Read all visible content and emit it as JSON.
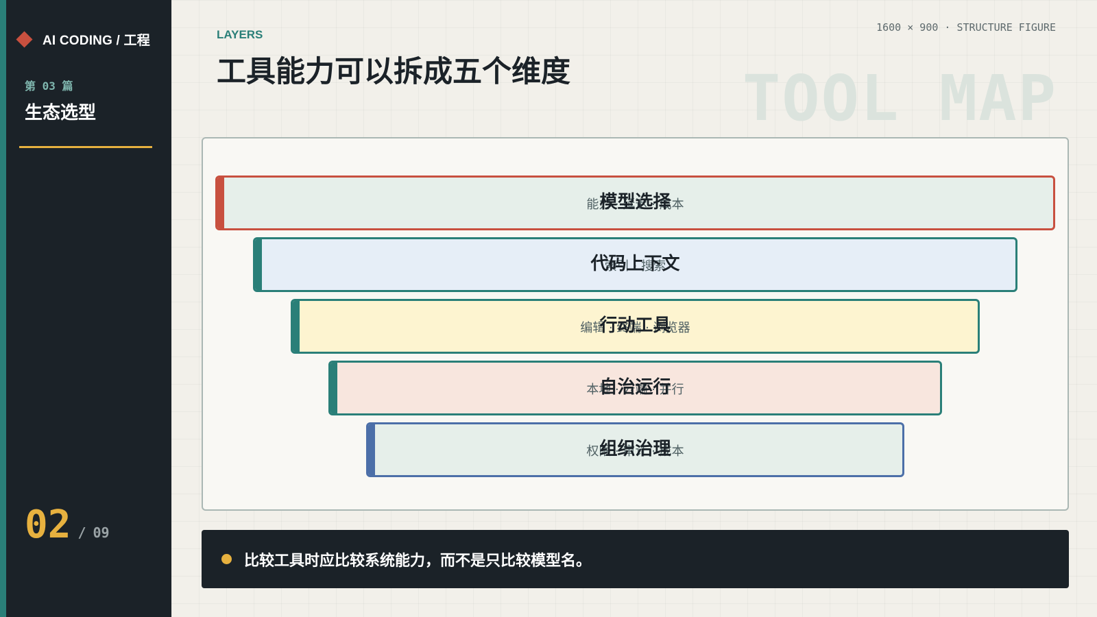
{
  "sidebar": {
    "brand": "AI CODING / 工程",
    "brand_icon": "diamond-icon",
    "chapter": "第 03 篇",
    "section": "生态选型",
    "page_current": "02",
    "page_separator": "/",
    "page_total": "09",
    "colors": {
      "background": "#1b2228",
      "stripe": "#2a7f78",
      "accent": "#e7b13f"
    }
  },
  "header": {
    "eyebrow": "LAYERS",
    "title": "工具能力可以拆成五个维度",
    "meta": "1600 × 900 · STRUCTURE FIGURE",
    "watermark": "TOOL MAP"
  },
  "diagram": {
    "layers": [
      {
        "title": "模型选择",
        "subtitle": "能力 · 延迟 · 成本",
        "border_color": "#c8503f",
        "accent_color": "#c8503f",
        "fill": "#e6efea"
      },
      {
        "title": "代码上下文",
        "subtitle": "索引 · 搜索",
        "border_color": "#2a7f78",
        "accent_color": "#2a7f78",
        "fill": "#e6eef7"
      },
      {
        "title": "行动工具",
        "subtitle": "编辑 · 终端 · 浏览器",
        "border_color": "#2a7f78",
        "accent_color": "#2a7f78",
        "fill": "#fdf4d0"
      },
      {
        "title": "自治运行",
        "subtitle": "本地 · 云端 · 并行",
        "border_color": "#2a7f78",
        "accent_color": "#2a7f78",
        "fill": "#f8e6de"
      },
      {
        "title": "组织治理",
        "subtitle": "权限 · 审计 · 成本",
        "border_color": "#4c6fa8",
        "accent_color": "#4c6fa8",
        "fill": "#e6efea"
      }
    ]
  },
  "callout": {
    "text": "比较工具时应比较系统能力，而不是只比较模型名。"
  }
}
